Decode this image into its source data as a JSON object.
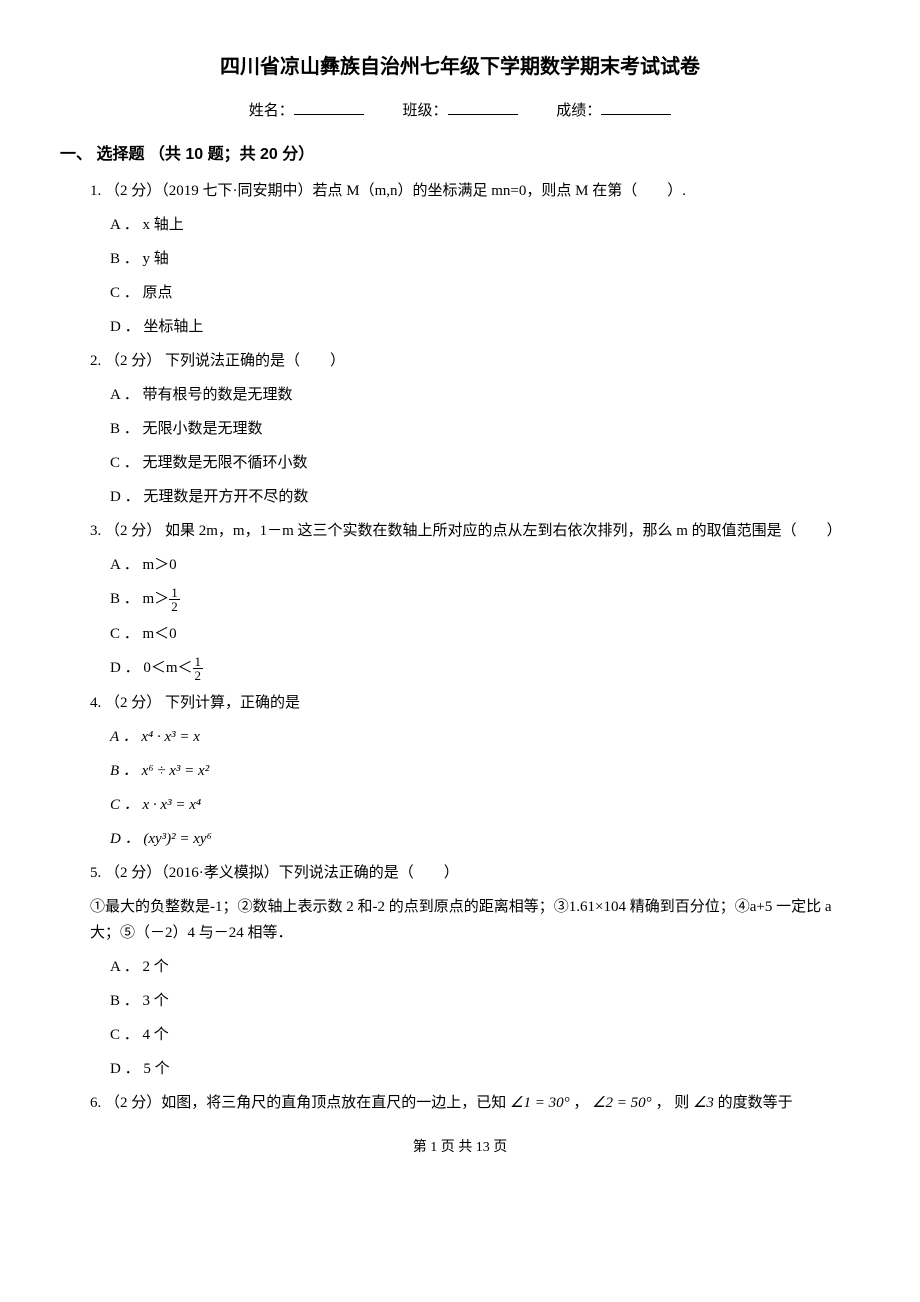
{
  "title": "四川省凉山彝族自治州七年级下学期数学期末考试试卷",
  "meta": {
    "name_label": "姓名：",
    "class_label": "班级：",
    "score_label": "成绩："
  },
  "section1": "一、 选择题 （共 10 题；共 20 分）",
  "q1": {
    "stem": "1. （2 分）（2019 七下·同安期中）若点 M（m,n）的坐标满足 mn=0，则点 M 在第（　　）.",
    "a": "A ． x 轴上",
    "b": "B ． y 轴",
    "c": "C ． 原点",
    "d": "D ． 坐标轴上"
  },
  "q2": {
    "stem": "2. （2 分） 下列说法正确的是（　　）",
    "a": "A ． 带有根号的数是无理数",
    "b": "B ． 无限小数是无理数",
    "c": "C ． 无理数是无限不循环小数",
    "d": "D ． 无理数是开方开不尽的数"
  },
  "q3": {
    "stem": "3. （2 分） 如果 2m，m，1－m 这三个实数在数轴上所对应的点从左到右依次排列，那么 m 的取值范围是（　　）",
    "a": "A ． m＞0",
    "b_pre": "B ． m＞",
    "c": "C ． m＜0",
    "d_pre": "D ． 0＜m＜"
  },
  "q4": {
    "stem": "4. （2 分） 下列计算，正确的是",
    "a": "A ． x⁴ · x³ = x",
    "b": "B ． x⁶ ÷ x³ = x²",
    "c": "C ． x · x³ = x⁴",
    "d": "D ． (xy³)² = xy⁶"
  },
  "q5": {
    "stem": "5. （2 分）（2016·孝义模拟）下列说法正确的是（　　）",
    "sub": "①最大的负整数是-1；②数轴上表示数 2 和-2 的点到原点的距离相等；③1.61×104 精确到百分位；④a+5 一定比 a 大；⑤（－2）4 与－24 相等．",
    "a": "A ． 2 个",
    "b": "B ． 3 个",
    "c": "C ． 4 个",
    "d": "D ． 5 个"
  },
  "q6": {
    "stem_pre": "6. （2 分）如图，将三角尺的直角顶点放在直尺的一边上，已知",
    "ang1": "∠1 = 30°",
    "sep1": "， ",
    "ang2": "∠2 = 50°",
    "sep2": "， 则",
    "ang3": "∠3",
    "stem_post": "的度数等于"
  },
  "footer": "第 1 页 共 13 页"
}
